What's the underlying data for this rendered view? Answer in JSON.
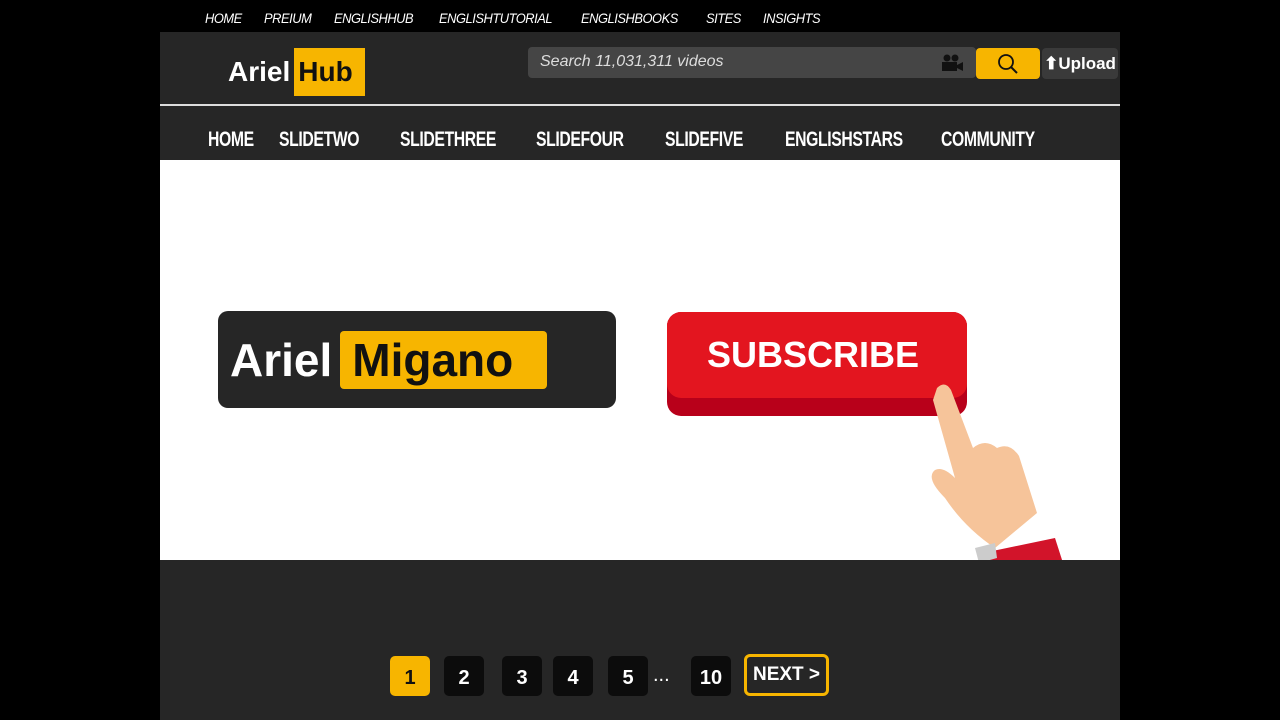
{
  "topnav": [
    "HOME",
    "PREIUM",
    "ENGLISHHUB",
    "ENGLISHTUTORIAL",
    "ENGLISHBOOKS",
    "SITES",
    "INSIGHTS"
  ],
  "logo": {
    "part1": "Ariel",
    "part2": "Hub"
  },
  "search": {
    "placeholder": "Search 11,031,311 videos"
  },
  "upload_label": "Upload",
  "mainnav": [
    "HOME",
    "SLIDETWO",
    "SLIDETHREE",
    "SLIDEFOUR",
    "SLIDEFIVE",
    "ENGLISHSTARS",
    "COMMUNITY"
  ],
  "banner": {
    "name1": "Ariel",
    "name2": "Migano",
    "subscribe": "SUBSCRIBE"
  },
  "pagination": {
    "pages": [
      "1",
      "2",
      "3",
      "4",
      "5",
      "10"
    ],
    "ellipsis": "...",
    "next": "NEXT >",
    "current": "1"
  },
  "colors": {
    "accent": "#f7b500",
    "subscribe": "#e3151f"
  }
}
